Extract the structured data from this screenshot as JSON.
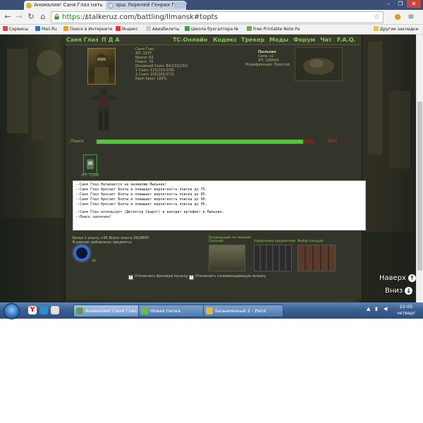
{
  "browser": {
    "tabs": [
      {
        "label": "Аномалия! Саня Глаз нать"
      },
      {
        "label": "эрш Лорелей Генрих Гейне"
      }
    ],
    "url_https": "https://",
    "url_rest": "stalkeruz.com/battling/llmansk#topts",
    "bookmarks": [
      {
        "label": "Сервисы"
      },
      {
        "label": "Mail.Ru"
      },
      {
        "label": "Поиск в Интернете"
      },
      {
        "label": "Яндекс"
      },
      {
        "label": "Авиабилеты"
      },
      {
        "label": "Школа бухгалтера №"
      },
      {
        "label": "Free Printable Note Pa"
      },
      {
        "label": "Другие закладки"
      }
    ]
  },
  "game": {
    "menu": [
      "Саня Глаз",
      "П Д А",
      "ТС-Онлайн",
      "Кодекс",
      "Трекер",
      "Моды",
      "Форум",
      "Чат",
      "F.A.Q."
    ],
    "player": {
      "name": "Саня Глаз",
      "stats": [
        "ХП: 1537",
        "Броня: 62",
        "Поиск: 70",
        "Основной Скил: 84(210/232)",
        "1 Скил: 131(101/156)",
        "2 Скил: 105(201/372)",
        "Крит.Урон: 182%"
      ]
    },
    "enemy": {
      "name": "Пыльник",
      "stats": [
        "Сила: х1",
        "ХП: 100500",
        "Модификация: Простой."
      ]
    },
    "search": {
      "label": "Поиск",
      "percent_text": "95%",
      "progress": 0.95
    },
    "item_hp": "ХП - 1200",
    "log": [
      "--Саня Глаз Натыкается на аномалию Пыльник!",
      "--Саня Глаз бросает Болты и повышает вероятность поиска до  75.",
      "--Саня Глаз бросает Болты и повышает вероятность поиска до  85.",
      "--Саня Глаз бросает Болты и повышает вероятность поиска до  90.",
      "--Саня Глаз бросает Болты и повышает вероятность поиска до  95.",
      "",
      "--Саня Глаз использует (Детектор Сварог) и находит артефакт в Пыльник.",
      "--Поиск закончен!"
    ],
    "bonus_line1": "Бонус к опыту +95 Всего опыта 2828897.",
    "bonus_line2": "В рюкзак добавлены предметы:",
    "artifact_count": "x1",
    "thumbs": [
      {
        "title": "Предыдущие на локации",
        "subtitle": "Пыльник"
      },
      {
        "title": "Управление предметами",
        "subtitle": ""
      },
      {
        "title": "Выбор локаций",
        "subtitle": ""
      }
    ],
    "checkboxes": [
      {
        "label": "Отключать фоновую музыку",
        "checked": true
      },
      {
        "label": "Отключать сопровождающую музыку",
        "checked": true
      }
    ],
    "nav_up": "Наверх",
    "nav_down": "Вниз"
  },
  "taskbar": {
    "items": [
      {
        "label": "Аномалия! Саня Глаз..."
      },
      {
        "label": "Новая папка"
      },
      {
        "label": "Безымянный 2 - Paint"
      }
    ],
    "time": "22:05",
    "day": "четверг"
  },
  "colors": {
    "accent_green": "#7fc45a",
    "progress_fill": "#5bbf43",
    "progress_track": "#6b2a2a",
    "percent_red": "#d04040"
  }
}
